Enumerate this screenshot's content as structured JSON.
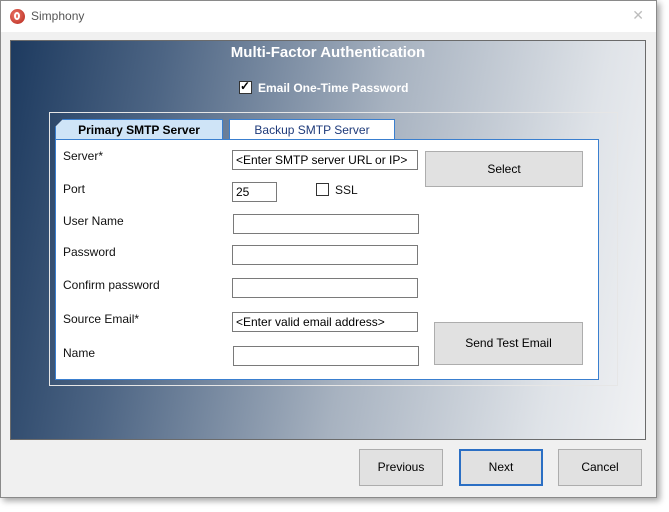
{
  "window": {
    "title": "Simphony"
  },
  "dialog": {
    "heading": "Multi-Factor Authentication",
    "otp_label": "Email One-Time Password",
    "otp_checked": true
  },
  "tabs": [
    {
      "label": "Primary SMTP Server",
      "active": true
    },
    {
      "label": "Backup SMTP Server",
      "active": false
    }
  ],
  "form": {
    "server_label": "Server*",
    "server_value": "<Enter SMTP server URL or IP>",
    "port_label": "Port",
    "port_value": "25",
    "ssl_label": "SSL",
    "ssl_checked": false,
    "username_label": "User Name",
    "username_value": "",
    "password_label": "Password",
    "password_value": "",
    "confirm_label": "Confirm password",
    "confirm_value": "",
    "source_email_label": "Source Email*",
    "source_email_value": "<Enter valid email address>",
    "name_label": "Name",
    "name_value": "",
    "select_button": "Select",
    "send_test_button": "Send Test Email"
  },
  "footer": {
    "previous": "Previous",
    "next": "Next",
    "cancel": "Cancel"
  }
}
